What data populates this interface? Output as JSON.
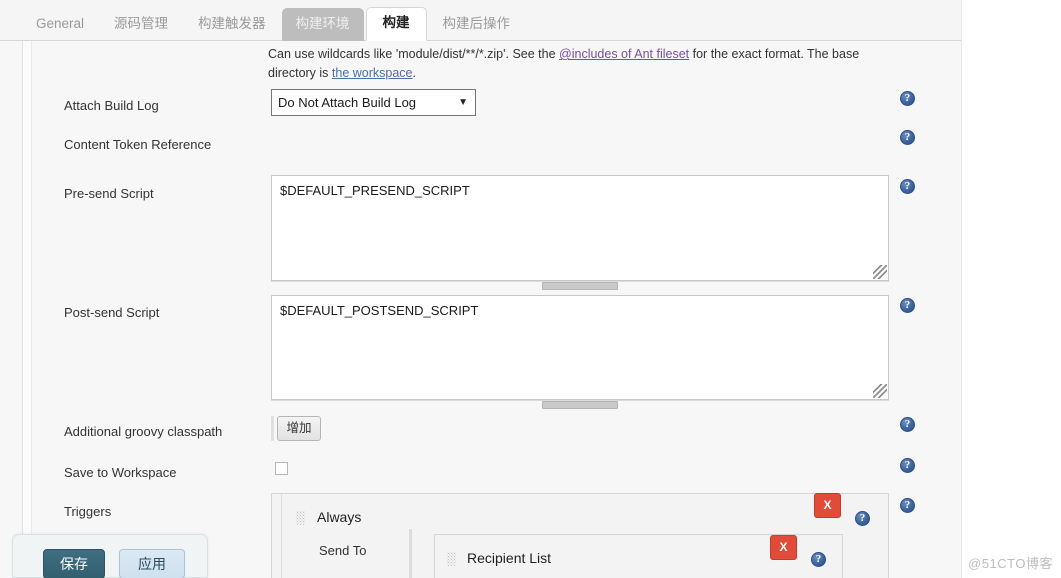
{
  "tabs": [
    {
      "label": "General",
      "state": "normal"
    },
    {
      "label": "源码管理",
      "state": "normal"
    },
    {
      "label": "构建触发器",
      "state": "normal"
    },
    {
      "label": "构建环境",
      "state": "hover"
    },
    {
      "label": "构建",
      "state": "active"
    },
    {
      "label": "构建后操作",
      "state": "normal"
    }
  ],
  "help_blurb": {
    "part1": "Can use wildcards like 'module/dist/**/*.zip'. See the ",
    "link1": "@includes of Ant fileset",
    "part2": " for the exact format. The base directory is ",
    "link2": "the workspace",
    "part3": "."
  },
  "fields": {
    "attach_build_log": {
      "label": "Attach Build Log",
      "value": "Do Not Attach Build Log",
      "arrow": "▼"
    },
    "content_token_reference": {
      "label": "Content Token Reference"
    },
    "pre_send_script": {
      "label": "Pre-send Script",
      "value": "$DEFAULT_PRESEND_SCRIPT"
    },
    "post_send_script": {
      "label": "Post-send Script",
      "value": "$DEFAULT_POSTSEND_SCRIPT"
    },
    "additional_groovy_classpath": {
      "label": "Additional groovy classpath",
      "add_button": "增加"
    },
    "save_to_workspace": {
      "label": "Save to Workspace",
      "checked": false
    },
    "triggers": {
      "label": "Triggers",
      "trigger_name": "Always",
      "send_to_label": "Send To",
      "recipient_name": "Recipient List",
      "delete_label": "X"
    }
  },
  "action_bar": {
    "save_label": "保存",
    "apply_label": "应用"
  },
  "watermark": "@51CTO博客",
  "colors": {
    "delete_red": "#e04b3a",
    "help_blue": "#3e65a0",
    "save_teal": "#33606f",
    "apply_blue": "#cfe0ee",
    "link_purple": "#7b4f9d"
  }
}
